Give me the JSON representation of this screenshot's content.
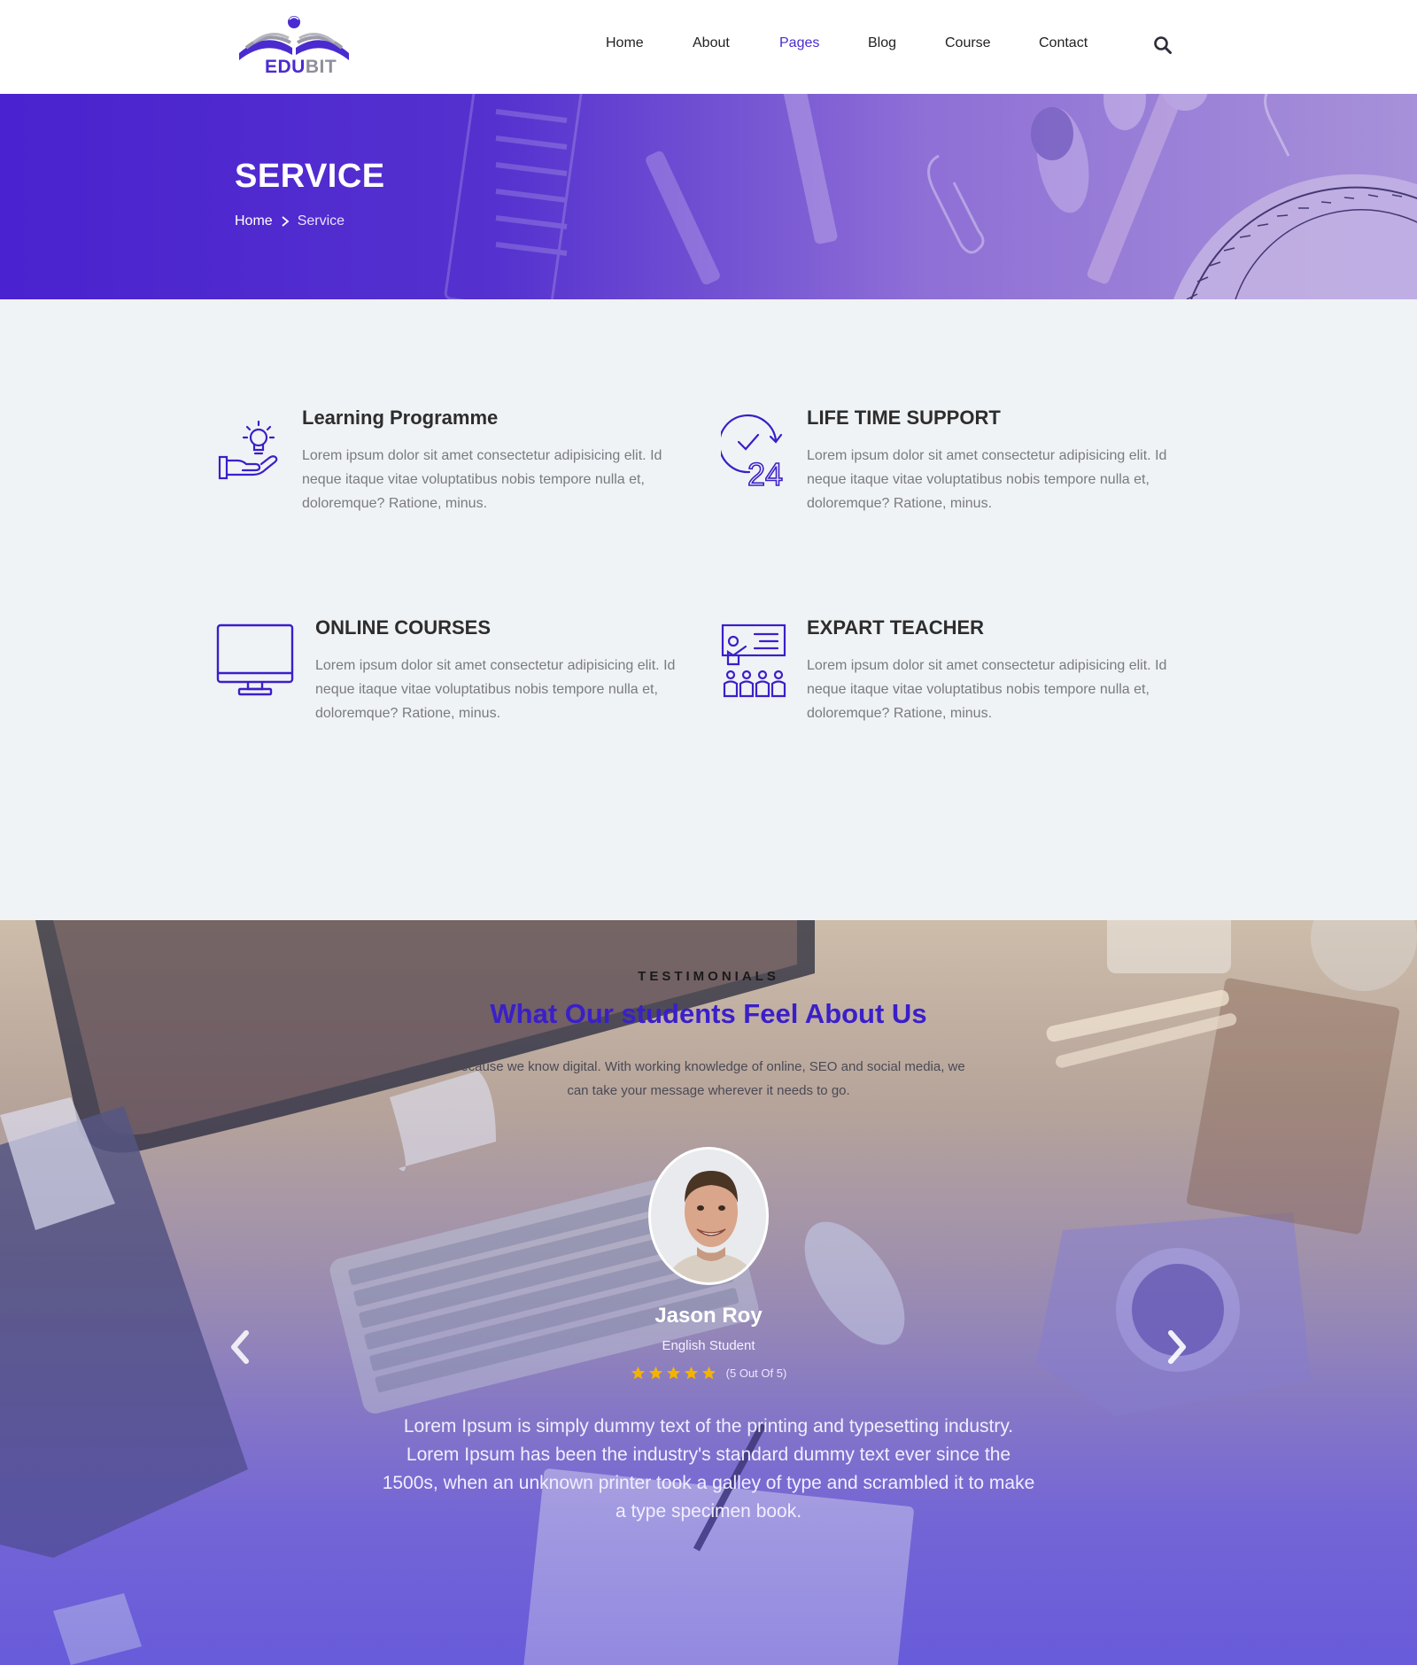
{
  "brand": {
    "part1": "EDU",
    "part2": "BIT"
  },
  "nav": {
    "items": [
      {
        "label": "Home",
        "active": false
      },
      {
        "label": "About",
        "active": false
      },
      {
        "label": "Pages",
        "active": true
      },
      {
        "label": "Blog",
        "active": false
      },
      {
        "label": "Course",
        "active": false
      },
      {
        "label": "Contact",
        "active": false
      }
    ],
    "search_icon": "search-icon"
  },
  "hero": {
    "title": "SERVICE",
    "breadcrumb": {
      "home": "Home",
      "current": "Service"
    }
  },
  "services": [
    {
      "icon": "lightbulb-hand-icon",
      "title": "Learning Programme",
      "text": "Lorem ipsum dolor sit amet consectetur adipisicing elit. Id neque itaque vitae voluptatibus nobis tempore nulla et, doloremque? Ratione, minus."
    },
    {
      "icon": "clock-24-icon",
      "title": "LIFE TIME SUPPORT",
      "text": "Lorem ipsum dolor sit amet consectetur adipisicing elit. Id neque itaque vitae voluptatibus nobis tempore nulla et, doloremque? Ratione, minus."
    },
    {
      "icon": "monitor-icon",
      "title": "ONLINE COURSES",
      "text": "Lorem ipsum dolor sit amet consectetur adipisicing elit. Id neque itaque vitae voluptatibus nobis tempore nulla et, doloremque? Ratione, minus."
    },
    {
      "icon": "teacher-board-icon",
      "title": "EXPART TEACHER",
      "text": "Lorem ipsum dolor sit amet consectetur adipisicing elit. Id neque itaque vitae voluptatibus nobis tempore nulla et, doloremque? Ratione, minus."
    }
  ],
  "testimonials": {
    "eyebrow": "TESTIMONIALS",
    "heading": "What Our students Feel About Us",
    "subtitle": "Because we know digital. With working knowledge of online, SEO and social media, we can take your message wherever it needs to go.",
    "person": {
      "name": "Jason Roy",
      "role": "English Student"
    },
    "rating": {
      "value": 5,
      "max": 5,
      "label": "(5 Out Of 5)"
    },
    "quote": "Lorem Ipsum is simply dummy text of the printing and typesetting industry. Lorem Ipsum has been the industry's standard dummy text ever since the 1500s, when an unknown printer took a galley of type and scrambled it to make a type specimen book.",
    "prev_icon": "chevron-left-icon",
    "next_icon": "chevron-right-icon"
  },
  "colors": {
    "accent": "#4a2bd0",
    "star": "#f5b301",
    "text_muted": "#7a7a80",
    "page_bg": "#f0f3f5"
  }
}
